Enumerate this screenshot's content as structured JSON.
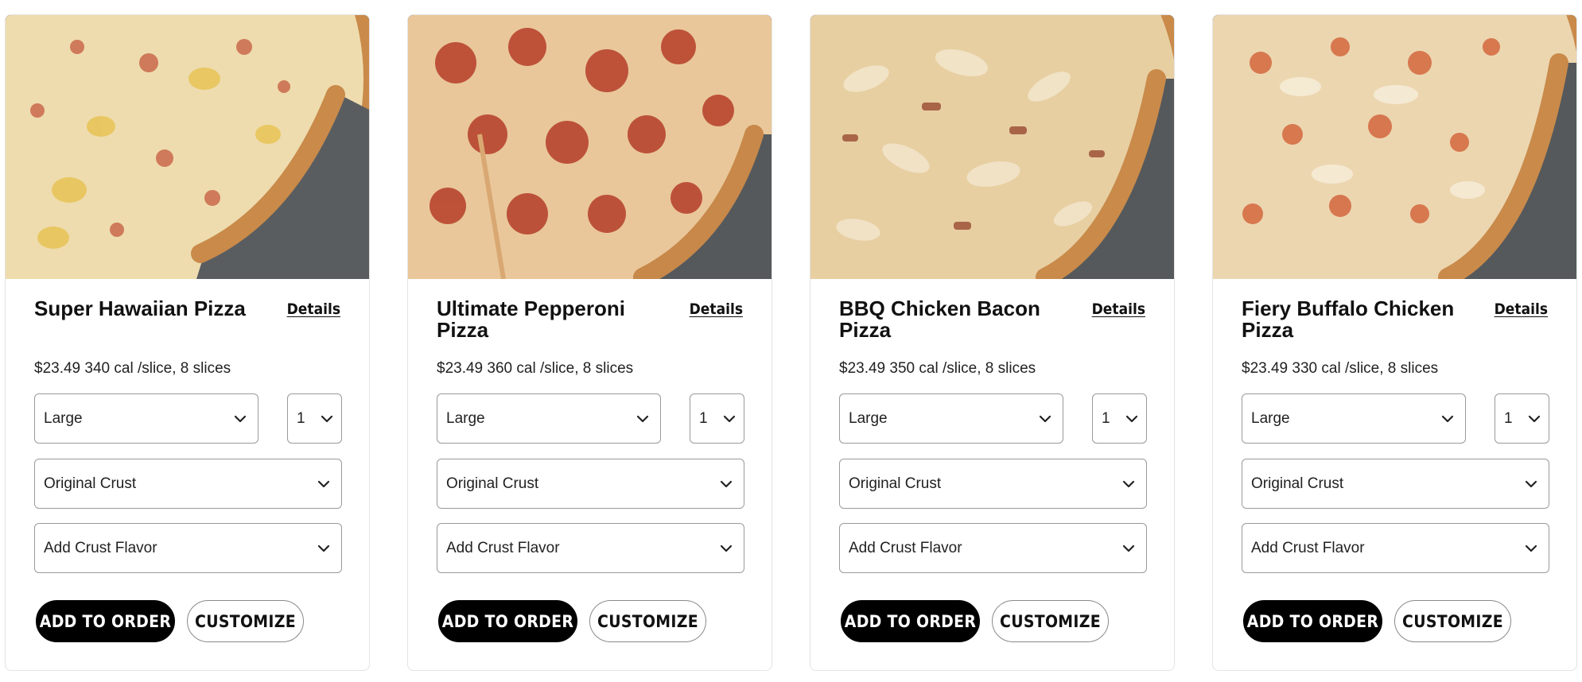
{
  "products": [
    {
      "name": "Super Hawaiian Pizza",
      "details_label": "Details",
      "price_text": "$23.49 340 cal /slice, 8 slices",
      "size": "Large",
      "quantity": "1",
      "crust": "Original Crust",
      "crust_flavor": "Add Crust Flavor",
      "add_label": "ADD TO ORDER",
      "customize_label": "CUSTOMIZE"
    },
    {
      "name": "Ultimate Pepperoni Pizza",
      "details_label": "Details",
      "price_text": "$23.49 360 cal /slice, 8 slices",
      "size": "Large",
      "quantity": "1",
      "crust": "Original Crust",
      "crust_flavor": "Add Crust Flavor",
      "add_label": "ADD TO ORDER",
      "customize_label": "CUSTOMIZE"
    },
    {
      "name": "BBQ Chicken Bacon Pizza",
      "details_label": "Details",
      "price_text": "$23.49 350 cal /slice, 8 slices",
      "size": "Large",
      "quantity": "1",
      "crust": "Original Crust",
      "crust_flavor": "Add Crust Flavor",
      "add_label": "ADD TO ORDER",
      "customize_label": "CUSTOMIZE"
    },
    {
      "name": "Fiery Buffalo Chicken Pizza",
      "details_label": "Details",
      "price_text": "$23.49 330 cal /slice, 8 slices",
      "size": "Large",
      "quantity": "1",
      "crust": "Original Crust",
      "crust_flavor": "Add Crust Flavor",
      "add_label": "ADD TO ORDER",
      "customize_label": "CUSTOMIZE"
    }
  ],
  "colors": {
    "primary_button": "#000000",
    "primary_button_text": "#ffffff",
    "card_border": "#e3e3e3",
    "select_border": "#9a9a9a"
  },
  "icons": {
    "dropdown": "chevron-down-icon"
  }
}
